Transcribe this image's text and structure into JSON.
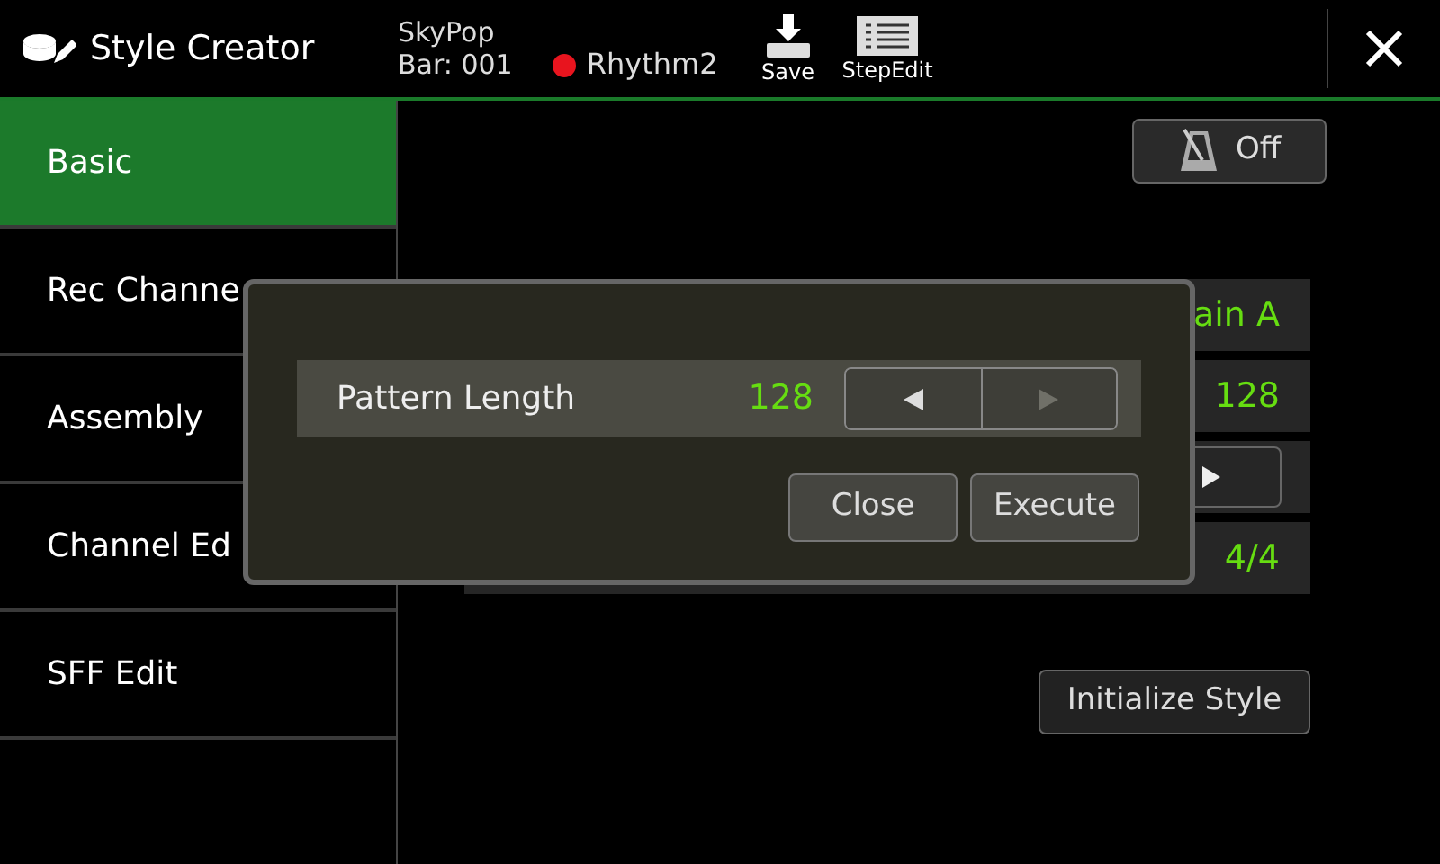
{
  "header": {
    "title": "Style Creator",
    "style_name": "SkyPop",
    "bar": "Bar: 001",
    "channel": "Rhythm2",
    "save": "Save",
    "step_edit": "StepEdit"
  },
  "sidebar": {
    "items": [
      {
        "label": "Basic",
        "selected": true
      },
      {
        "label": "Rec Channe",
        "selected": false
      },
      {
        "label": "Assembly",
        "selected": false
      },
      {
        "label": "Channel Ed",
        "selected": false
      },
      {
        "label": "SFF Edit",
        "selected": false
      }
    ]
  },
  "metronome": {
    "label": "Off"
  },
  "rows": [
    {
      "kind": "value",
      "value": "ain A"
    },
    {
      "kind": "value",
      "value": "128"
    },
    {
      "kind": "arrow"
    },
    {
      "kind": "value",
      "value": "4/4"
    }
  ],
  "initialize": "Initialize Style",
  "dialog": {
    "label": "Pattern Length",
    "value": "128",
    "arrows": [
      {
        "kind": "left",
        "disabled": false
      },
      {
        "kind": "right",
        "disabled": true
      }
    ],
    "buttons": [
      "Close",
      "Execute"
    ]
  }
}
